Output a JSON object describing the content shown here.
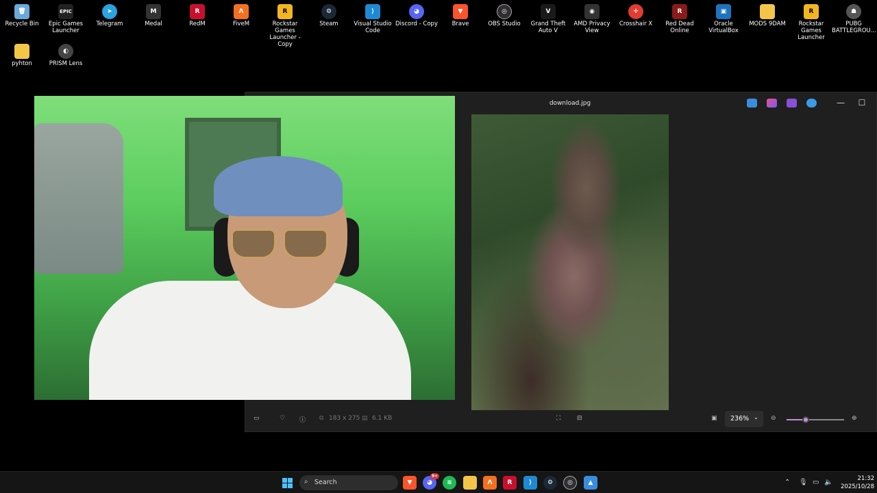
{
  "desktop_icons": [
    {
      "label": "Recycle Bin",
      "icon": "recycle-bin-icon",
      "color": "#6aa9d8"
    },
    {
      "label": "Epic Games Launcher",
      "icon": "epic-games-icon",
      "color": "#222222",
      "glyph": "EPIC"
    },
    {
      "label": "Telegram",
      "icon": "telegram-icon",
      "color": "#2aa3e0"
    },
    {
      "label": "Medal",
      "icon": "medal-icon",
      "color": "#333333"
    },
    {
      "label": "RedM",
      "icon": "redm-icon",
      "color": "#c8102e"
    },
    {
      "label": "FiveM",
      "icon": "fivem-icon",
      "color": "#f37021"
    },
    {
      "label": "Rockstar Games Launcher - Copy",
      "icon": "rockstar-icon",
      "color": "#f3b61f",
      "glyph": "R"
    },
    {
      "label": "Steam",
      "icon": "steam-icon",
      "color": "#1b2838"
    },
    {
      "label": "Visual Studio Code",
      "icon": "vscode-icon",
      "color": "#1f8ad2"
    },
    {
      "label": "Discord - Copy",
      "icon": "discord-icon",
      "color": "#5865f2"
    },
    {
      "label": "Brave",
      "icon": "brave-icon",
      "color": "#fb542b"
    },
    {
      "label": "OBS Studio",
      "icon": "obs-icon",
      "color": "#302e31"
    },
    {
      "label": "Grand Theft Auto V",
      "icon": "gta-icon",
      "color": "#1a1a1a"
    },
    {
      "label": "AMD Privacy View",
      "icon": "amd-icon",
      "color": "#333333"
    },
    {
      "label": "Crosshair X",
      "icon": "crosshair-icon",
      "color": "#e03c31"
    },
    {
      "label": "Red Dead Online",
      "icon": "red-dead-icon",
      "color": "#8b1a1a"
    },
    {
      "label": "Oracle VirtualBox",
      "icon": "virtualbox-icon",
      "color": "#1e73be"
    },
    {
      "label": "MODS 9DAM",
      "icon": "folder-icon",
      "color": "#f3c64a"
    },
    {
      "label": "Rockstar Games Launcher",
      "icon": "rockstar-icon",
      "color": "#f3b61f",
      "glyph": "R"
    },
    {
      "label": "PUBG BATTLEGROU...",
      "icon": "pubg-icon",
      "color": "#555555"
    },
    {
      "label": "pyhton",
      "icon": "folder-icon",
      "color": "#f3c64a"
    },
    {
      "label": "PRISM Lens",
      "icon": "prism-lens-icon",
      "color": "#444444"
    }
  ],
  "photos_app": {
    "file_name": "download.jpg",
    "dimensions": "183 x 275",
    "file_size": "6.1 KB",
    "zoom_level": "236%",
    "zoom_slider_fraction": 0.33,
    "minimize_glyph": "—",
    "maximize_glyph": "☐",
    "accent": "#c38fd6"
  },
  "taskbar": {
    "search_placeholder": "Search",
    "time": "21:32",
    "date": "2025/10/28",
    "apps": [
      {
        "icon": "brave-icon",
        "color": "#fb542b"
      },
      {
        "icon": "discord-icon",
        "color": "#5865f2",
        "badge": "9+"
      },
      {
        "icon": "spotify-icon",
        "color": "#1db954"
      },
      {
        "icon": "file-explorer-icon",
        "color": "#f3c64a"
      },
      {
        "icon": "fivem-icon",
        "color": "#f37021"
      },
      {
        "icon": "redm-icon",
        "color": "#c8102e"
      },
      {
        "icon": "vscode-icon",
        "color": "#1f8ad2"
      },
      {
        "icon": "steam-icon",
        "color": "#1b2838"
      },
      {
        "icon": "obs-icon",
        "color": "#302e31"
      },
      {
        "icon": "photos-icon",
        "color": "#3a8dde"
      }
    ]
  }
}
